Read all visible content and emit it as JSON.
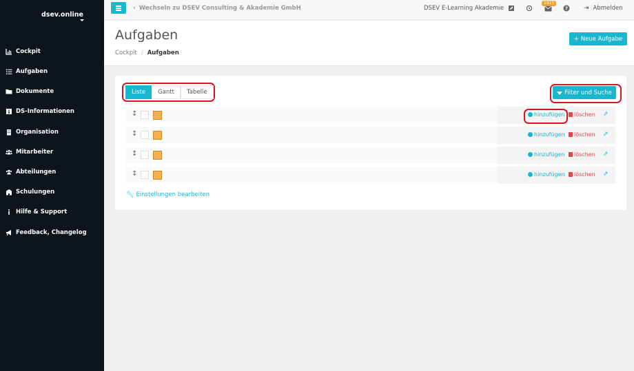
{
  "sidebar": {
    "brand": "dsev.online",
    "items": [
      {
        "label": "Cockpit",
        "icon": "chart-icon"
      },
      {
        "label": "Aufgaben",
        "icon": "list-icon"
      },
      {
        "label": "Dokumente",
        "icon": "folder-icon"
      },
      {
        "label": "DS-Informationen",
        "icon": "info-card-icon"
      },
      {
        "label": "Organisation",
        "icon": "building-icon"
      },
      {
        "label": "Mitarbeiter",
        "icon": "users-icon"
      },
      {
        "label": "Abteilungen",
        "icon": "users-icon"
      },
      {
        "label": "Schulungen",
        "icon": "school-icon"
      },
      {
        "label": "Hilfe & Support",
        "icon": "info-icon"
      },
      {
        "label": "Feedback, Changelog",
        "icon": "megaphone-icon"
      }
    ]
  },
  "topbar": {
    "switch_label": "Wechseln zu DSEV Consulting & Akademie GmbH",
    "akademie_label": "DSEV E-Learning Akademie",
    "mail_badge": "1915",
    "logout_label": "Abmelden"
  },
  "header": {
    "title": "Aufgaben",
    "breadcrumb_root": "Cockpit",
    "breadcrumb_current": "Aufgaben",
    "new_button": "+ Neue Aufgabe"
  },
  "card": {
    "tabs": [
      "Liste",
      "Gantt",
      "Tabelle"
    ],
    "active_tab": "Liste",
    "filter_button": "Filter und Suche",
    "row_actions": {
      "add": "hinzufügen",
      "delete": "löschen"
    },
    "settings_link": "Einstellungen bearbeiten"
  },
  "colors": {
    "accent": "#17b7d0",
    "sidebar": "#0e141b",
    "danger": "#e04848",
    "task_color": "#f4b04a",
    "highlight": "#d6141e"
  }
}
